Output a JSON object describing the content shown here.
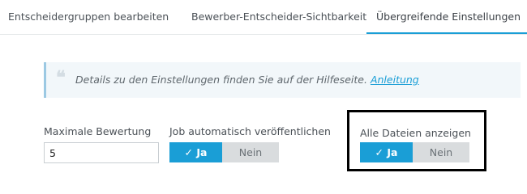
{
  "tabs": [
    {
      "label": "Entscheidergruppen bearbeiten",
      "active": false
    },
    {
      "label": "Bewerber-Entscheider-Sichtbarkeit",
      "active": false
    },
    {
      "label": "Übergreifende Einstellungen",
      "active": true
    }
  ],
  "info": {
    "text": "Details zu den Einstellungen finden Sie auf der Hilfeseite.",
    "link_label": "Anleitung",
    "quote_icon": "quote-icon"
  },
  "fields": {
    "max_rating": {
      "label": "Maximale Bewertung",
      "value": "5"
    },
    "job_publish": {
      "label": "Job automatisch veröffentlichen",
      "yes": "Ja",
      "no": "Nein",
      "selected": "Ja"
    },
    "show_all_files": {
      "label": "Alle Dateien anzeigen",
      "yes": "Ja",
      "no": "Nein",
      "selected": "Ja"
    }
  },
  "colors": {
    "accent": "#1a9ed6",
    "toggle_off": "#d9dcde"
  }
}
